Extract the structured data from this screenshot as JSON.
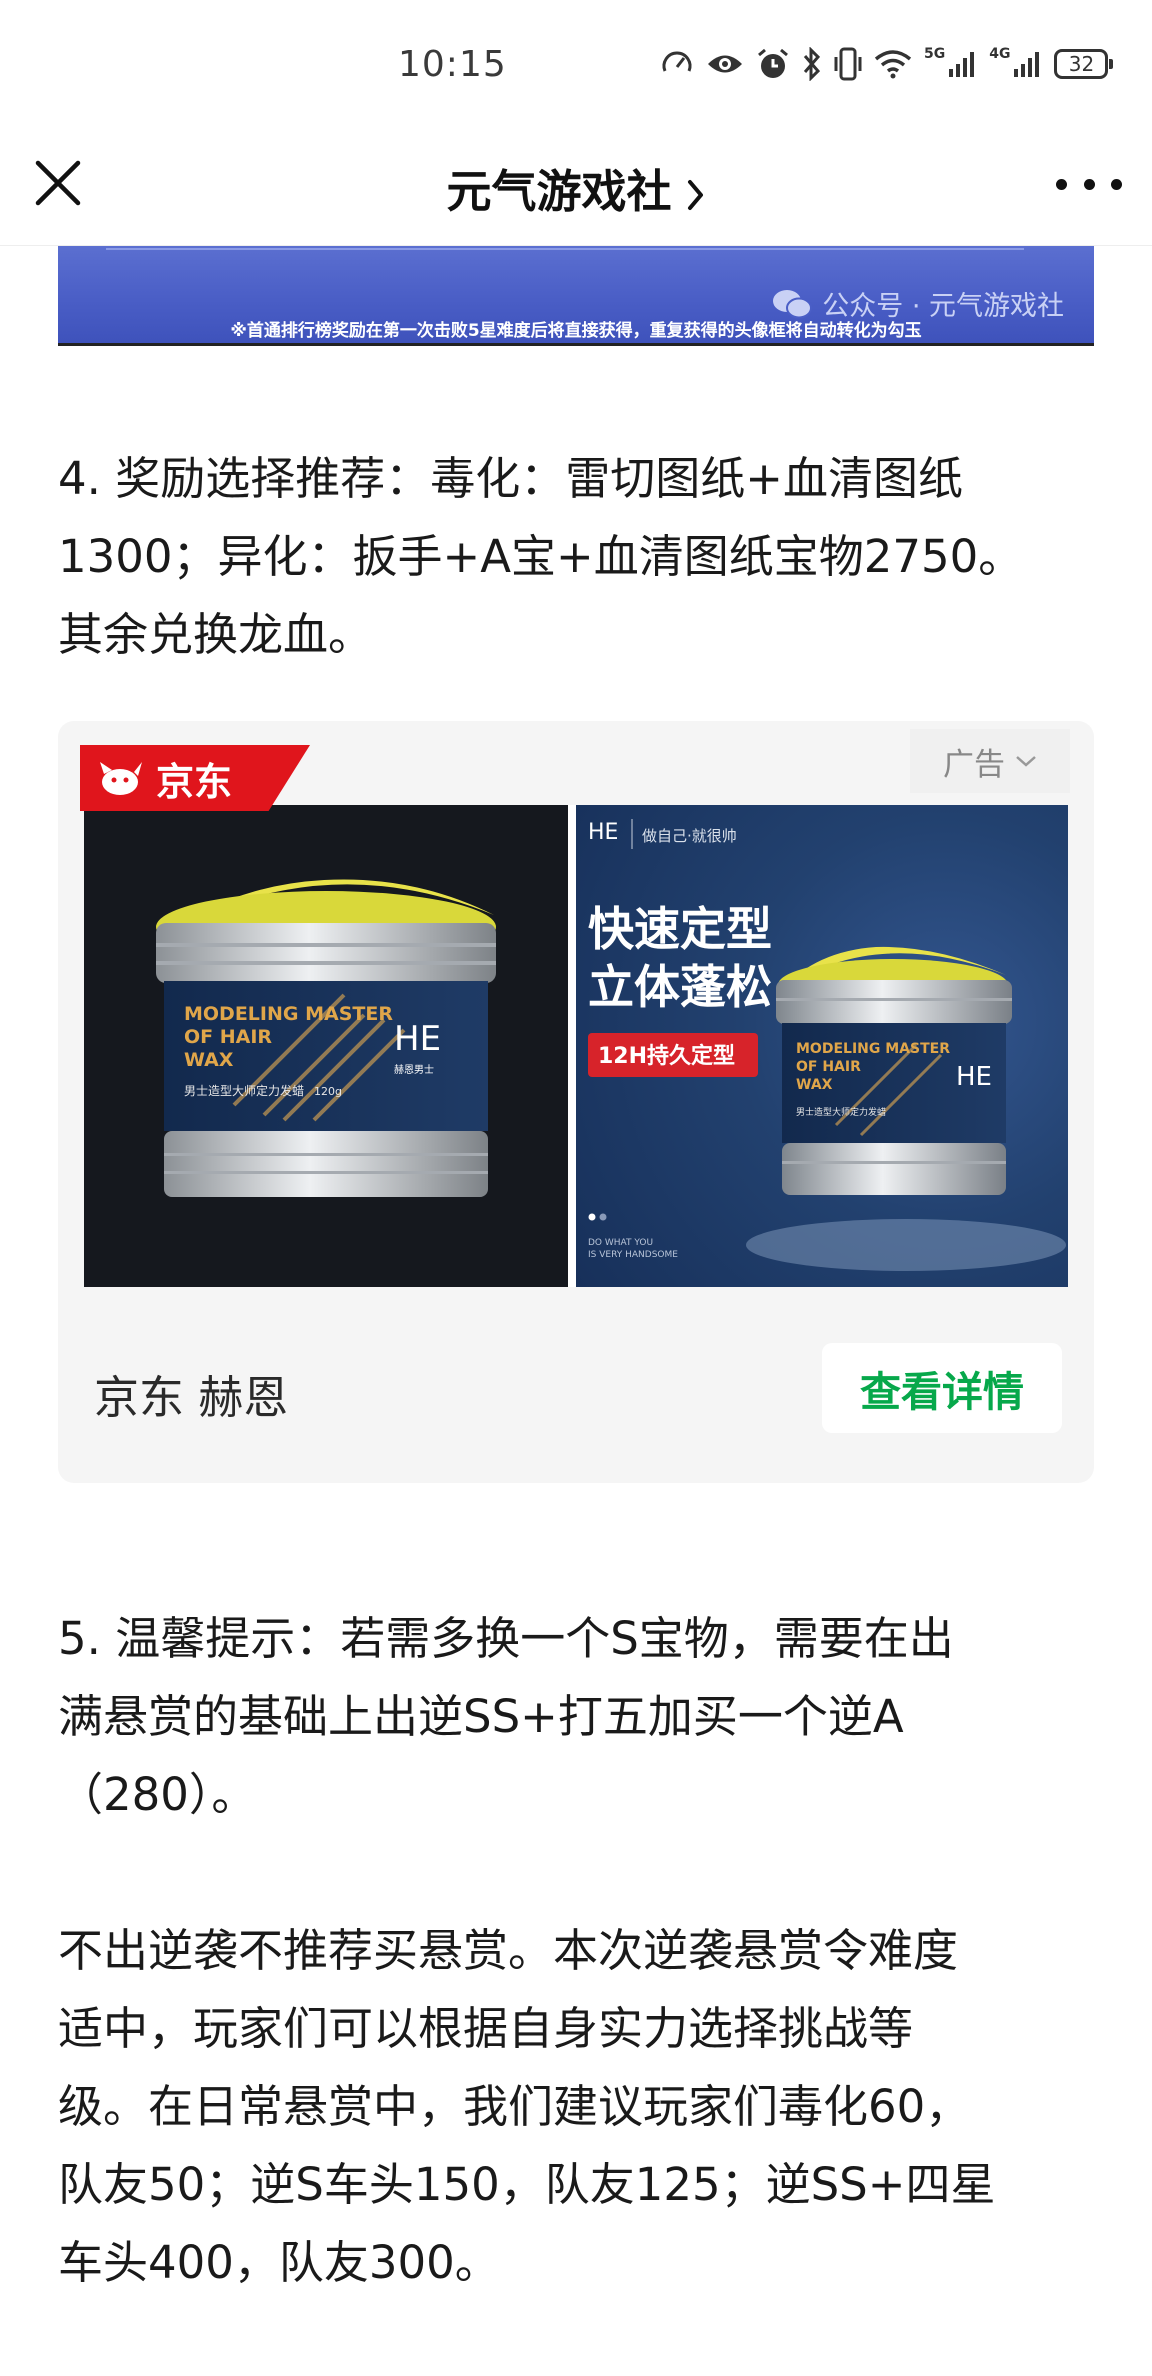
{
  "status_bar": {
    "time": "10:15",
    "net1": "5G",
    "net2": "4G",
    "battery": "32"
  },
  "nav": {
    "title": "元气游戏社",
    "close_icon": "close-icon",
    "more_icon": "more-dots-icon"
  },
  "banner": {
    "watermark": "公众号 · 元气游戏社",
    "note": "※首通排行榜奖励在第一次击败5星难度后将直接获得，重复获得的头像框将自动转化为勾玉"
  },
  "article": {
    "para4": [
      "4. 奖励选择推荐：毒化：雷切图纸+血清图纸",
      "1300；异化：扳手+A宝+血清图纸宝物2750。",
      "其余兑换龙血。"
    ],
    "para5": [
      "5. 温馨提示：若需多换一个S宝物，需要在出",
      "满悬赏的基础上出逆SS+打五加买一个逆A",
      "（280）。"
    ],
    "para6": [
      "不出逆袭不推荐买悬赏。本次逆袭悬赏令难度",
      "适中，玩家们可以根据自身实力选择挑战等",
      "级。在日常悬赏中，我们建议玩家们毒化60，",
      "队友50；逆S车头150，队友125；逆SS+四星",
      "车头400，队友300。"
    ]
  },
  "ad": {
    "tag": "广告",
    "brand_badge": "京东",
    "source": "京东 赫恩",
    "cta": "查看详情",
    "image_left": {
      "label_lines": [
        "MODELING MASTER",
        "OF HAIR",
        "WAX"
      ],
      "sub": "男士造型大师定力发蜡",
      "weight": "120g",
      "logo_sub": "赫恩男士"
    },
    "image_right": {
      "slogan_small": "做自己·就很帅",
      "headline1": "快速定型",
      "headline2": "立体蓬松",
      "badge": "12H持久定型",
      "label_lines": [
        "MODELING MASTER",
        "OF HAIR",
        "WAX"
      ],
      "sub": "男士造型大师定力发蜡",
      "footer_lines": [
        "DO WHAT YOU",
        "IS VERY HANDSOME"
      ]
    }
  },
  "colors": {
    "cta_green": "#07a84b",
    "jd_red": "#e0151c",
    "banner_blue": "#4a5ec6"
  }
}
